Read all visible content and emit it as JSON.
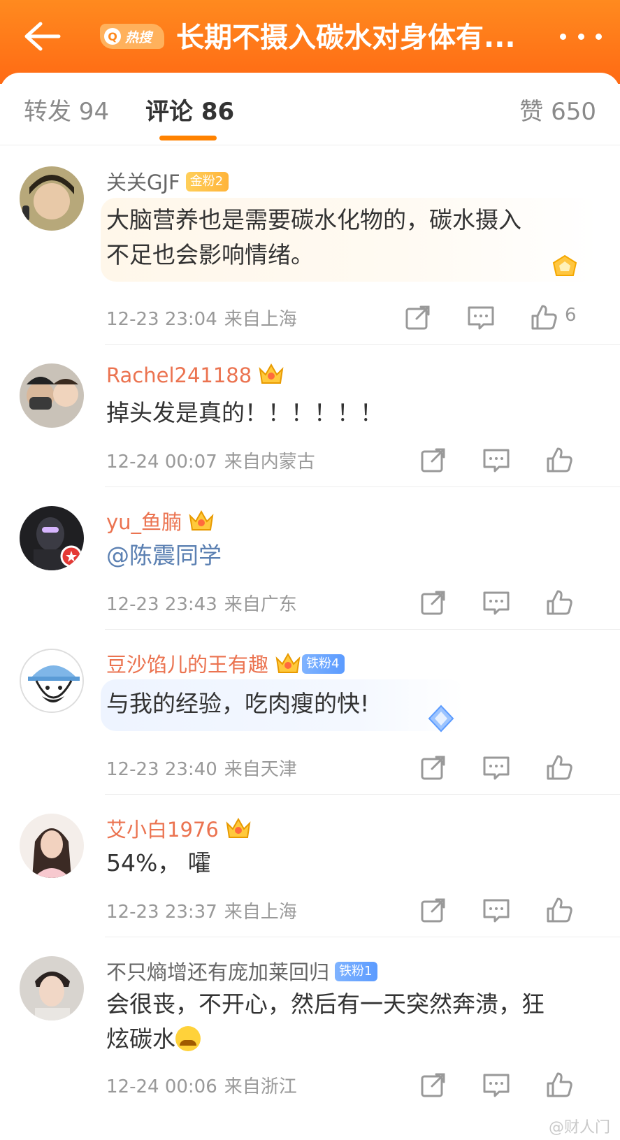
{
  "header": {
    "hot_tag": "热搜",
    "title": "长期不摄入碳水对身体有...",
    "colors": {
      "bg_top": "#ff8a1f",
      "bg_bottom": "#ff6a14"
    }
  },
  "tabs": {
    "reposts": "转发 94",
    "comments": "评论 86",
    "likes": "赞 650",
    "active": "comments",
    "accent": "#ff8200"
  },
  "comments": [
    {
      "username": "关关GJF",
      "badge": "金粉2",
      "content": [
        "大脑营养也是需要碳水化物的，碳水摄入",
        "不足也会影响情绪。"
      ],
      "time": "12-23 23:04",
      "location": "来自上海",
      "likes": "6"
    },
    {
      "username": "Rachel241188",
      "content": [
        "掉头发是真的！！！！！！"
      ],
      "time": "12-24 00:07",
      "location": "来自内蒙古"
    },
    {
      "username": "yu_鱼腩",
      "content": [
        "@陈震同学"
      ],
      "time": "12-23 23:43",
      "location": "来自广东"
    },
    {
      "username": "豆沙馅儿的王有趣",
      "badge": "铁粉4",
      "content": [
        "与我的经验，吃肉瘦的快!"
      ],
      "time": "12-23 23:40",
      "location": "来自天津"
    },
    {
      "username": "艾小白1976",
      "content": [
        "54%， 嚯"
      ],
      "time": "12-23 23:37",
      "location": "来自上海"
    },
    {
      "username": "不只熵增还有庞加莱回归",
      "badge": "铁粉1",
      "content": [
        "会很丧，不开心，然后有一天突然奔溃，狂",
        "炫碳水"
      ],
      "time": "12-24 00:06",
      "location": "来自浙江"
    }
  ],
  "watermark": "@财人门",
  "icons": [
    "back-arrow-icon",
    "search-icon",
    "more-icon",
    "repost-icon",
    "comment-icon",
    "like-icon",
    "crown-icon",
    "diamond-icon",
    "crying-emoji-icon"
  ]
}
